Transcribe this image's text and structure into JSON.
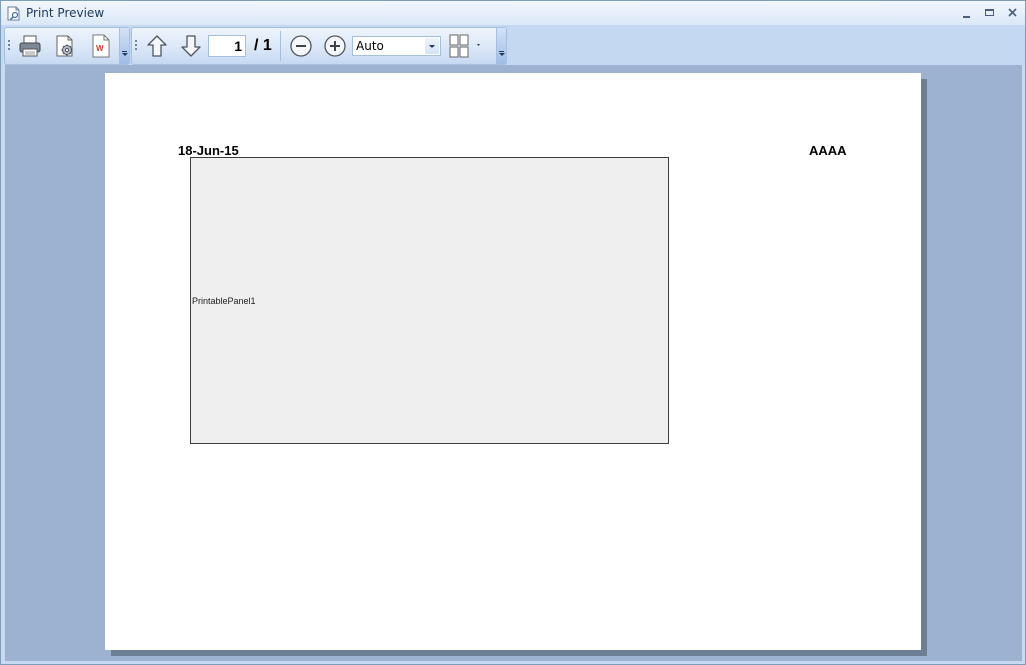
{
  "window": {
    "title": "Print Preview",
    "controls": {
      "minimize": "minimize-icon",
      "maximize": "maximize-icon",
      "close": "close-icon"
    }
  },
  "toolbar": {
    "file_group": [
      {
        "name": "print-button",
        "icon": "printer-icon"
      },
      {
        "name": "page-setup-button",
        "icon": "page-setup-gear-icon"
      },
      {
        "name": "export-word-button",
        "icon": "word-document-icon"
      }
    ],
    "navigation": {
      "previous_page": "arrow-up-icon",
      "next_page": "arrow-down-icon",
      "current_page": "1",
      "total_pages": "/ 1"
    },
    "zoom": {
      "zoom_out": "zoom-out-icon",
      "zoom_in": "zoom-in-icon",
      "value": "Auto"
    },
    "layout_button": "multiple-pages-icon"
  },
  "preview": {
    "page": {
      "date": "18-Jun-15",
      "header_right": "AAAA",
      "panel_label": "PrintablePanel1"
    }
  },
  "colors": {
    "preview_background": "#9db2d0",
    "toolbar_background": "#c5d8f1",
    "title_text": "#1e395b",
    "panel_background": "#efefef"
  }
}
